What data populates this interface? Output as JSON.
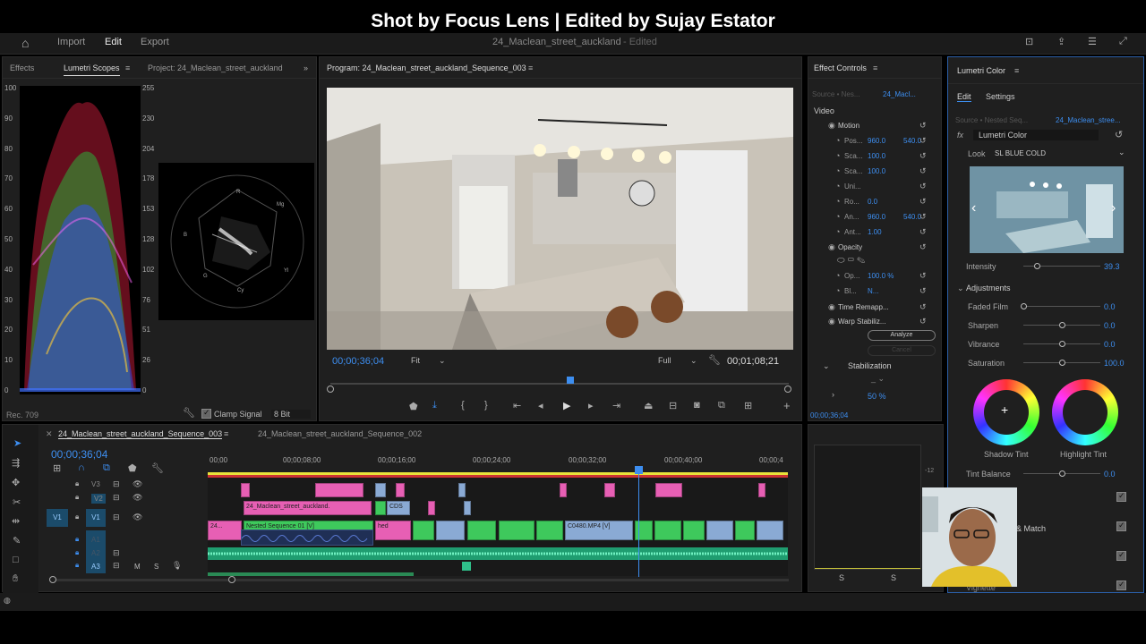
{
  "banner": "Shot by Focus Lens | Edited by Sujay Estator",
  "topnav": {
    "import": "Import",
    "edit": "Edit",
    "export": "Export",
    "doc_title": "24_Maclean_street_auckland",
    "edited": "- Edited"
  },
  "left_panel": {
    "tabs": [
      "Effects",
      "Lumetri Scopes",
      "Project: 24_Maclean_street_auckland"
    ],
    "scale_left": [
      "100",
      "90",
      "80",
      "70",
      "60",
      "50",
      "40",
      "30",
      "20",
      "10",
      "0"
    ],
    "scale_right": [
      "255",
      "230",
      "204",
      "178",
      "153",
      "128",
      "102",
      "76",
      "51",
      "26",
      "0"
    ],
    "vec_labels": [
      "R",
      "Mg",
      "B",
      "Cy",
      "G",
      "Yl"
    ],
    "rec": "Rec. 709",
    "clamp": "Clamp Signal",
    "bits": "8 Bit"
  },
  "program": {
    "title": "Program: 24_Maclean_street_auckland_Sequence_003",
    "timecode": "00;00;36;04",
    "fit": "Fit",
    "quality": "Full",
    "duration": "00;01;08;21"
  },
  "effect_controls": {
    "title": "Effect Controls",
    "source": "Source • Nes...",
    "seq": "24_Macl...",
    "video": "Video",
    "rows": [
      {
        "label": "Motion",
        "v1": "",
        "v2": ""
      },
      {
        "label": "Pos...",
        "v1": "960.0",
        "v2": "540.0"
      },
      {
        "label": "Sca...",
        "v1": "100.0",
        "v2": ""
      },
      {
        "label": "Sca...",
        "v1": "100.0",
        "v2": ""
      },
      {
        "label": "Uni...",
        "v1": "",
        "v2": ""
      },
      {
        "label": "Ro...",
        "v1": "0.0",
        "v2": ""
      },
      {
        "label": "An...",
        "v1": "960.0",
        "v2": "540.0"
      },
      {
        "label": "Ant...",
        "v1": "1.00",
        "v2": ""
      },
      {
        "label": "Opacity",
        "v1": "",
        "v2": ""
      },
      {
        "label": "Op...",
        "v1": "100.0 %",
        "v2": ""
      },
      {
        "label": "Bl...",
        "v1": "N...",
        "v2": ""
      },
      {
        "label": "Time Remapp...",
        "v1": "",
        "v2": ""
      },
      {
        "label": "Warp Stabiliz...",
        "v1": "",
        "v2": ""
      }
    ],
    "analyze": "Analyze",
    "cancel": "Cancel",
    "stabilization": "Stabilization",
    "pct": "50 %",
    "timecode": "00;00;36;04"
  },
  "lumetri": {
    "title": "Lumetri Color",
    "tab_edit": "Edit",
    "tab_settings": "Settings",
    "source": "Source • Nested Seq...",
    "seq": "24_Maclean_stree...",
    "fx": "Lumetri Color",
    "look_label": "Look",
    "look": "SL BLUE COLD",
    "intensity_label": "Intensity",
    "intensity": "39.3",
    "adjustments": "Adjustments",
    "sliders": [
      {
        "label": "Faded Film",
        "value": "0.0",
        "pos": 0.0
      },
      {
        "label": "Sharpen",
        "value": "0.0",
        "pos": 0.5
      },
      {
        "label": "Vibrance",
        "value": "0.0",
        "pos": 0.5
      },
      {
        "label": "Saturation",
        "value": "100.0",
        "pos": 0.5
      }
    ],
    "shadow_tint": "Shadow Tint",
    "highlight_tint": "Highlight Tint",
    "tint_balance": "Tint Balance",
    "tint_value": "0.0",
    "match": "& Match",
    "vignette": "Vignette"
  },
  "timeline": {
    "tab1": "24_Maclean_street_auckland_Sequence_003",
    "tab2": "24_Maclean_street_auckland_Sequence_002",
    "timecode": "00;00;36;04",
    "ruler": [
      "00;00",
      "00;00;08;00",
      "00;00;16;00",
      "00;00;24;00",
      "00;00;32;00",
      "00;00;40;00",
      "00;00;4"
    ],
    "tracks": [
      "V3",
      "V2",
      "V1",
      "A1",
      "A2",
      "A3"
    ],
    "v1_src": "V1",
    "clip_labels": [
      "24_Maclean_street_auckland.",
      "24...",
      "Nested Sequence 01 [V]",
      "hed",
      "C0480.MP4 [V]",
      "CDS"
    ]
  },
  "meter": {
    "scale": "-12",
    "s1": "S",
    "s2": "S"
  },
  "colors": {
    "accent": "#3d8ef0",
    "pink": "#e75fb4",
    "green": "#3ec95c",
    "blue": "#8aaad4",
    "audio": "#2fbf8a"
  }
}
